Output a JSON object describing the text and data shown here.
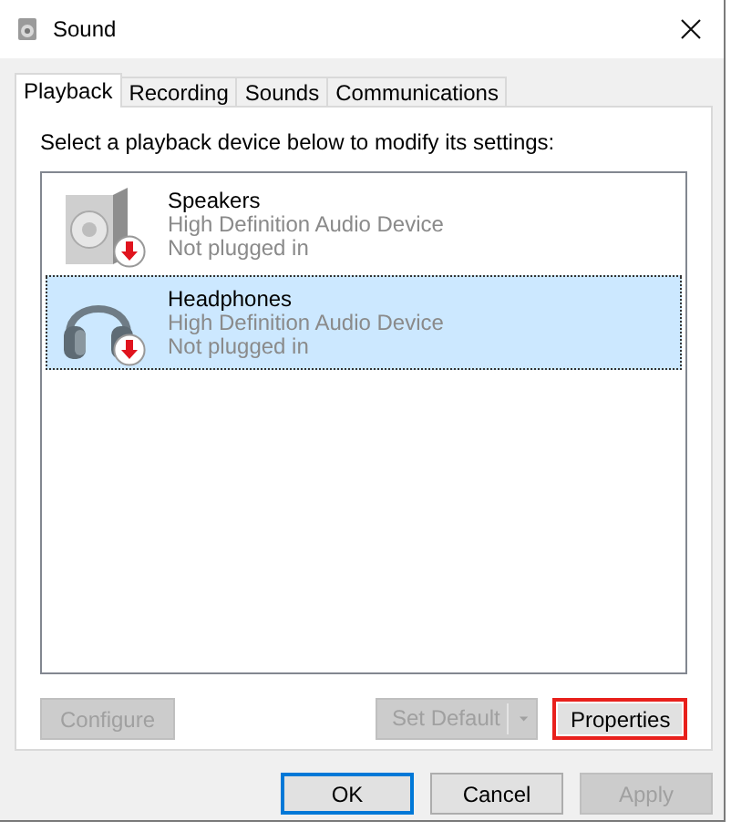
{
  "window": {
    "title": "Sound"
  },
  "tabs": [
    {
      "label": "Playback",
      "selected": true
    },
    {
      "label": "Recording",
      "selected": false
    },
    {
      "label": "Sounds",
      "selected": false
    },
    {
      "label": "Communications",
      "selected": false
    }
  ],
  "instruction": "Select a playback device below to modify its settings:",
  "devices": [
    {
      "kind": "speakers",
      "name": "Speakers",
      "description": "High Definition Audio Device",
      "status": "Not plugged in",
      "unplugged": true,
      "selected": false
    },
    {
      "kind": "headphones",
      "name": "Headphones",
      "description": "High Definition Audio Device",
      "status": "Not plugged in",
      "unplugged": true,
      "selected": true
    }
  ],
  "device_buttons": [
    {
      "kind": "configure",
      "label": "Configure",
      "disabled": true,
      "highlighted": false
    },
    {
      "kind": "set_default",
      "label": "Set Default",
      "disabled": true,
      "highlighted": false
    },
    {
      "kind": "properties",
      "label": "Properties",
      "disabled": false,
      "highlighted": true
    }
  ],
  "dialog_buttons": [
    {
      "label": "OK",
      "disabled": false,
      "default": true
    },
    {
      "label": "Cancel",
      "disabled": false,
      "default": false
    },
    {
      "label": "Apply",
      "disabled": true,
      "default": false
    }
  ]
}
